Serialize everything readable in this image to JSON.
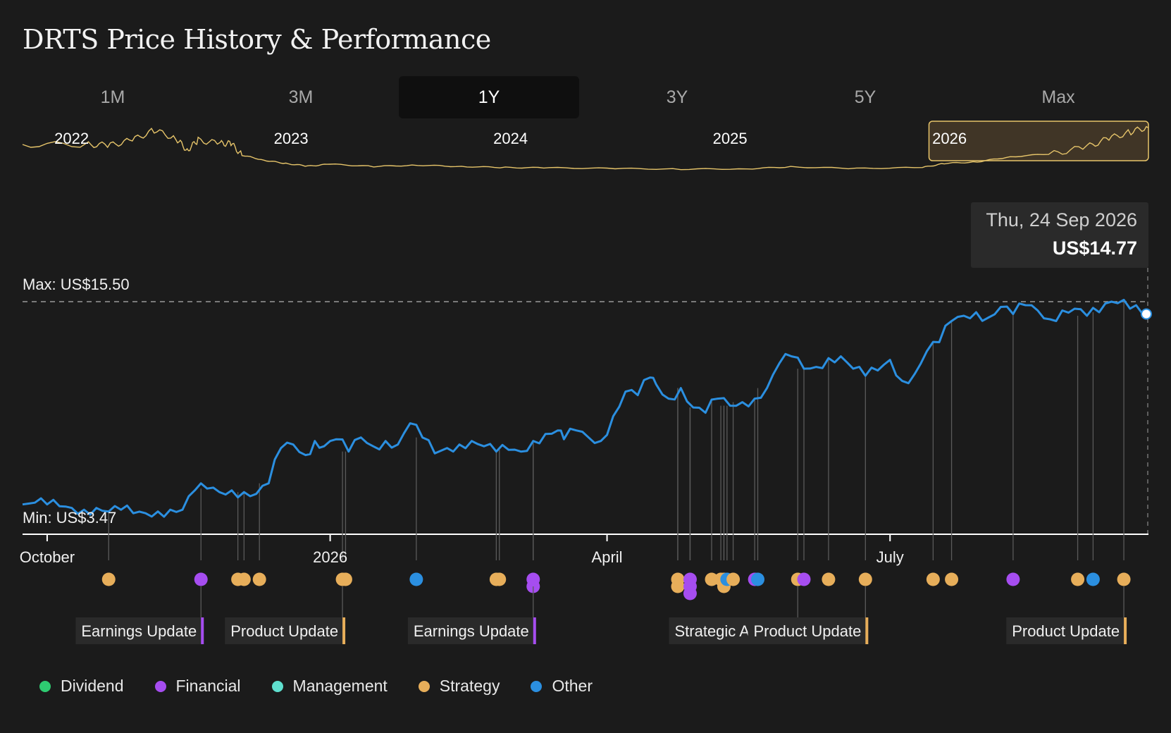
{
  "title": "DRTS Price History & Performance",
  "tabs": [
    {
      "label": "1M",
      "active": false
    },
    {
      "label": "3M",
      "active": false
    },
    {
      "label": "1Y",
      "active": true
    },
    {
      "label": "3Y",
      "active": false
    },
    {
      "label": "5Y",
      "active": false
    },
    {
      "label": "Max",
      "active": false
    }
  ],
  "tooltip": {
    "date": "Thu, 24 Sep 2026",
    "price": "US$14.77"
  },
  "max_label": "Max: US$15.50",
  "min_label": "Min: US$3.47",
  "legend": [
    {
      "name": "Dividend",
      "color": "#2ecc71"
    },
    {
      "name": "Financial",
      "color": "#a64df0"
    },
    {
      "name": "Management",
      "color": "#5fe0cf"
    },
    {
      "name": "Strategy",
      "color": "#e7ae5a"
    },
    {
      "name": "Other",
      "color": "#2b8fe0"
    }
  ],
  "event_labels": [
    {
      "text": "Earnings Update",
      "category": "Financial"
    },
    {
      "text": "Product Update",
      "category": "Strategy"
    },
    {
      "text": "Earnings Update",
      "category": "Financial"
    },
    {
      "text": "Strategic Alliance",
      "category": "Strategy"
    },
    {
      "text": "Product Update",
      "category": "Strategy"
    },
    {
      "text": "Product Update",
      "category": "Strategy"
    }
  ],
  "chart_data": [
    {
      "type": "line",
      "name": "overview",
      "x_tick_labels": [
        "2022",
        "2023",
        "2024",
        "2025",
        "2026"
      ],
      "x": [
        2021.6,
        2021.9,
        2022.0,
        2022.1,
        2022.2,
        2022.3,
        2022.35,
        2022.4,
        2022.5,
        2022.55,
        2022.6,
        2022.7,
        2022.8,
        2022.9,
        2023.0,
        2023.2,
        2023.4,
        2023.6,
        2023.8,
        2024.0,
        2024.3,
        2024.6,
        2024.9,
        2025.1,
        2025.4,
        2025.7,
        2025.8,
        2025.95,
        2026.1,
        2026.3,
        2026.45,
        2026.55,
        2026.65,
        2026.73
      ],
      "values": [
        9.2,
        9.2,
        9.0,
        10.5,
        13.5,
        11.0,
        7.5,
        10.5,
        9.5,
        9.5,
        6.0,
        4.5,
        3.5,
        2.7,
        3.3,
        2.6,
        3.0,
        2.6,
        2.3,
        2.2,
        2.0,
        1.8,
        1.9,
        2.5,
        2.0,
        2.3,
        3.5,
        4.0,
        5.5,
        6.5,
        8.5,
        11.0,
        13.0,
        14.5
      ],
      "selected_range": [
        2025.73,
        2026.73
      ]
    },
    {
      "type": "line",
      "name": "price",
      "title": "DRTS Price History & Performance",
      "currency": "US$",
      "x_tick_labels": [
        "October",
        "2026",
        "April",
        "July"
      ],
      "max": 15.5,
      "min": 3.47,
      "ylim": [
        3.0,
        16.3
      ],
      "series_color": "#2b8fe0",
      "x": [
        0,
        4,
        8,
        12,
        16,
        20,
        24,
        28,
        32,
        36,
        40,
        44,
        48,
        52,
        56,
        60,
        64,
        68,
        72,
        76,
        80,
        84,
        88,
        92,
        95,
        98,
        102,
        106,
        110,
        114,
        118,
        122,
        126,
        130,
        134,
        138,
        142,
        146,
        150,
        154,
        158,
        162,
        166,
        170,
        174,
        176,
        180,
        184,
        188,
        192,
        196,
        200,
        204,
        206,
        210,
        214,
        218,
        222,
        226,
        230,
        234,
        238,
        242,
        246,
        250,
        254,
        258,
        262,
        266,
        270,
        274,
        278,
        282,
        286,
        290,
        294,
        298,
        302,
        306,
        310,
        314,
        318,
        322,
        326,
        330,
        334,
        338,
        342,
        346,
        350,
        354,
        358,
        362,
        366
      ],
      "values": [
        4.0,
        4.1,
        4.0,
        3.9,
        3.8,
        3.7,
        3.8,
        3.6,
        3.7,
        3.5,
        3.5,
        3.6,
        3.7,
        3.7,
        4.8,
        4.9,
        4.7,
        4.8,
        4.7,
        4.6,
        5.2,
        7.2,
        7.4,
        6.8,
        7.6,
        7.3,
        7.7,
        7.0,
        7.8,
        7.3,
        7.6,
        7.4,
        8.6,
        7.8,
        6.9,
        7.2,
        7.4,
        7.6,
        7.3,
        7.0,
        7.1,
        7.0,
        7.6,
        8.0,
        8.2,
        7.7,
        8.2,
        7.8,
        7.6,
        9.0,
        10.4,
        10.2,
        11.2,
        10.8,
        10.0,
        10.6,
        9.5,
        9.2,
        10.0,
        9.6,
        9.8,
        10.0,
        10.6,
        12.0,
        12.4,
        11.7,
        11.8,
        12.3,
        12.4,
        11.7,
        11.3,
        11.6,
        12.2,
        11.0,
        11.4,
        12.7,
        13.2,
        14.4,
        14.7,
        14.9,
        14.6,
        15.2,
        14.8,
        15.3,
        15.0,
        14.5,
        15.0,
        15.1,
        14.7,
        14.9,
        15.5,
        15.6,
        15.3,
        14.8
      ],
      "x_ticks": [
        {
          "label": "October",
          "x": 8
        },
        {
          "label": "2026",
          "x": 100
        },
        {
          "label": "April",
          "x": 190
        },
        {
          "label": "July",
          "x": 282
        }
      ],
      "events": [
        {
          "x": 28,
          "category": "Strategy"
        },
        {
          "x": 58,
          "category": "Financial",
          "label_index": 0
        },
        {
          "x": 70,
          "category": "Strategy"
        },
        {
          "x": 72,
          "category": "Strategy"
        },
        {
          "x": 77,
          "category": "Strategy"
        },
        {
          "x": 104,
          "category": "Strategy",
          "label_index": 1
        },
        {
          "x": 105,
          "category": "Strategy"
        },
        {
          "x": 128,
          "category": "Other"
        },
        {
          "x": 154,
          "category": "Strategy"
        },
        {
          "x": 155,
          "category": "Strategy"
        },
        {
          "x": 166,
          "category": "Financial",
          "label_index": 2
        },
        {
          "x": 166,
          "category": "Financial"
        },
        {
          "x": 213,
          "category": "Strategy"
        },
        {
          "x": 213,
          "category": "Strategy"
        },
        {
          "x": 217,
          "category": "Financial"
        },
        {
          "x": 217,
          "category": "Financial"
        },
        {
          "x": 217,
          "category": "Financial"
        },
        {
          "x": 224,
          "category": "Strategy"
        },
        {
          "x": 227,
          "category": "Strategy"
        },
        {
          "x": 228,
          "category": "Strategy"
        },
        {
          "x": 228,
          "category": "Strategy"
        },
        {
          "x": 229,
          "category": "Other"
        },
        {
          "x": 231,
          "category": "Strategy"
        },
        {
          "x": 238,
          "category": "Financial"
        },
        {
          "x": 239,
          "category": "Other"
        },
        {
          "x": 252,
          "category": "Strategy",
          "label_index": 3
        },
        {
          "x": 254,
          "category": "Financial"
        },
        {
          "x": 262,
          "category": "Strategy"
        },
        {
          "x": 274,
          "category": "Strategy",
          "label_index": 4
        },
        {
          "x": 296,
          "category": "Strategy"
        },
        {
          "x": 302,
          "category": "Strategy"
        },
        {
          "x": 322,
          "category": "Financial"
        },
        {
          "x": 343,
          "category": "Strategy"
        },
        {
          "x": 348,
          "category": "Other"
        },
        {
          "x": 358,
          "category": "Strategy",
          "label_index": 5
        }
      ]
    }
  ]
}
